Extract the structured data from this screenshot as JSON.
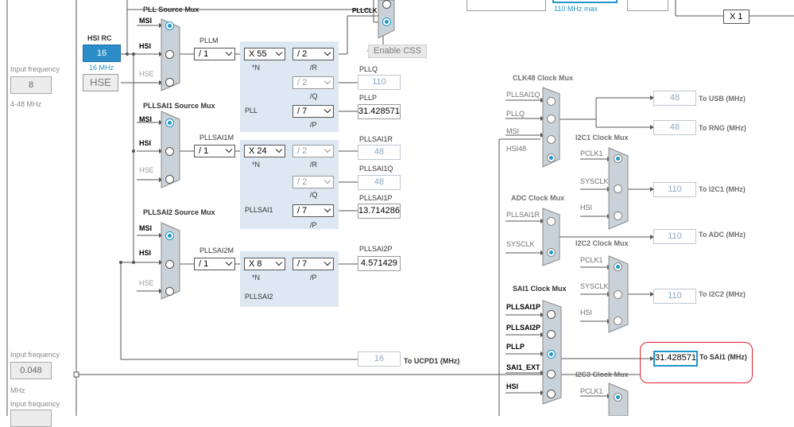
{
  "left_panel": {
    "hsi_input_label": "Input frequency",
    "hsi_input_value": "8",
    "hsi_range": "4-48 MHz",
    "lse_input_label": "Input frequency",
    "lse_input_value": "0.048",
    "lse_unit": "MHz",
    "bottom_input_label": "Input frequency"
  },
  "sources": {
    "hsi_rc_label": "HSI RC",
    "hsi_rc_value": "16",
    "hsi_rc_freq": "16 MHz",
    "hse_label": "HSE"
  },
  "pll_source_mux": {
    "title": "PLL Source Mux",
    "inputs": [
      "MSI",
      "HSI",
      "HSE"
    ]
  },
  "pllsai1_source_mux": {
    "title": "PLLSAI1 Source Mux",
    "inputs": [
      "MSI",
      "HSI",
      "HSE"
    ]
  },
  "pllsai2_source_mux": {
    "title": "PLLSAI2 Source Mux",
    "inputs": [
      "MSI",
      "HSI",
      "HSE"
    ]
  },
  "pll": {
    "name": "PLL",
    "m_label": "PLLM",
    "m_value": "/ 1",
    "n_value": "X 55",
    "n_label": "*N",
    "r_value": "/ 2",
    "r_label": "/R",
    "q_value": "/ 2",
    "q_label": "/Q",
    "p_value": "/ 7",
    "p_label": "/P",
    "q_out_label": "PLLQ",
    "q_out_value": "110",
    "p_out_label": "PLLP",
    "p_out_value": "31.428571",
    "pllclk_label": "PLLCLK",
    "enable_css": "Enable CSS",
    "max_note": "110 MHz max",
    "x1": "X 1"
  },
  "pllsai1": {
    "name": "PLLSAI1",
    "m_label": "PLLSAI1M",
    "m_value": "/ 1",
    "n_value": "X 24",
    "n_label": "*N",
    "r_value": "/ 2",
    "r_label": "/R",
    "q_value": "/ 2",
    "q_label": "/Q",
    "p_value": "/ 7",
    "p_label": "/P",
    "r_out_label": "PLLSAI1R",
    "r_out_value": "48",
    "q_out_label": "PLLSAI1Q",
    "q_out_value": "48",
    "p_out_label": "PLLSAI1P",
    "p_out_value": "13.714286"
  },
  "pllsai2": {
    "name": "PLLSAI2",
    "m_label": "PLLSAI2M",
    "m_value": "/ 1",
    "n_value": "X 8",
    "n_label": "*N",
    "p_value": "/ 7",
    "p_label": "/P",
    "p_out_label": "PLLSAI2P",
    "p_out_value": "4.571429"
  },
  "ucpd": {
    "value": "16",
    "label": "To UCPD1 (MHz)"
  },
  "clk48_mux": {
    "title": "CLK48 Clock Mux",
    "inputs": [
      "PLLSAI1Q",
      "PLLQ",
      "MSI",
      "HSI48"
    ],
    "usb_value": "48",
    "usb_label": "To USB (MHz)",
    "rng_value": "48",
    "rng_label": "To RNG (MHz)"
  },
  "i2c1_mux": {
    "title": "I2C1 Clock Mux",
    "inputs": [
      "PCLK1",
      "SYSCLK",
      "HSI"
    ],
    "value": "110",
    "label": "To I2C1 (MHz)"
  },
  "adc_mux": {
    "title": "ADC Clock Mux",
    "inputs": [
      "PLLSAI1R",
      "SYSCLK"
    ],
    "value": "110",
    "label": "To ADC (MHz)"
  },
  "i2c2_mux": {
    "title": "I2C2 Clock Mux",
    "inputs": [
      "PCLK1",
      "SYSCLK",
      "HSI"
    ],
    "value": "110",
    "label": "To I2C2 (MHz)"
  },
  "sai1_mux": {
    "title": "SAI1 Clock Mux",
    "inputs": [
      "PLLSAI1P",
      "PLLSAI2P",
      "PLLP",
      "SAI1_EXT",
      "HSI"
    ],
    "value": "31.428571",
    "label": "To SAI1 (MHz)"
  },
  "i2c3_mux": {
    "title": "I2C3 Clock Mux",
    "inputs": [
      "PCLK1"
    ]
  }
}
